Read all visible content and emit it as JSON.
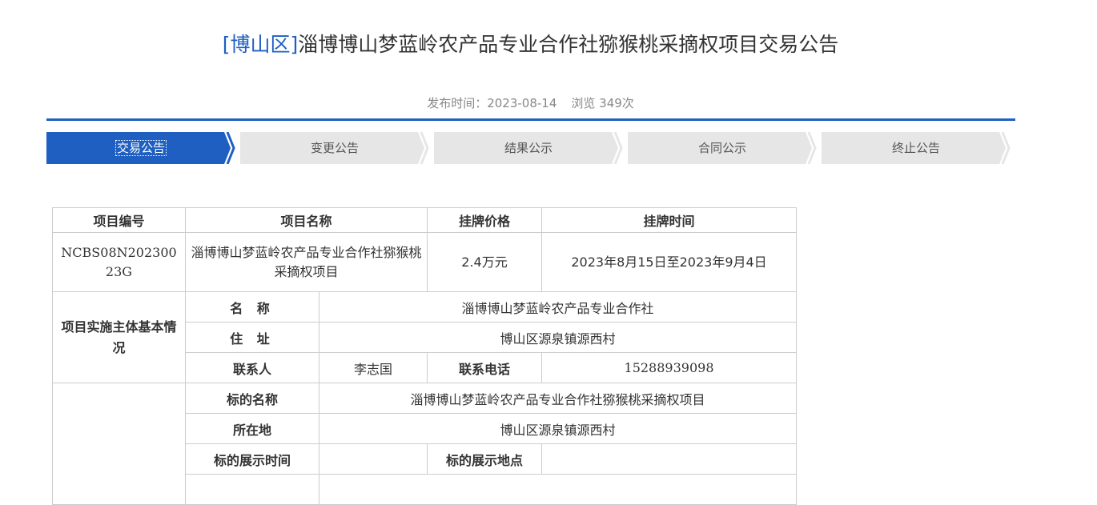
{
  "header": {
    "district": "[博山区]",
    "title": "淄博博山梦蓝岭农产品专业合作社猕猴桃采摘权项目交易公告",
    "publish_time": "发布时间：2023-08-14",
    "views": "浏览 349次"
  },
  "steps": [
    "交易公告",
    "变更公告",
    "结果公示",
    "合同公示",
    "终止公告"
  ],
  "accent_color": "#1e5fc1",
  "table": {
    "headers": {
      "project_no": "项目编号",
      "project_name": "项目名称",
      "list_price": "挂牌价格",
      "list_time": "挂牌时间"
    },
    "project": {
      "no": "NCBS08N20230023G",
      "name": "淄博博山梦蓝岭农产品专业合作社猕猴桃采摘权项目",
      "price": "2.4万元",
      "time": "2023年8月15日至2023年9月4日"
    },
    "entity_section": "项目实施主体基本情况",
    "entity": {
      "name_label": "名 称",
      "name": "淄博博山梦蓝岭农产品专业合作社",
      "address_label": "住 址",
      "address": "博山区源泉镇源西村",
      "contact_label": "联系人",
      "contact": "李志国",
      "phone_label": "联系电话",
      "phone": "15288939098"
    },
    "target": {
      "name_label": "标的名称",
      "name": "淄博博山梦蓝岭农产品专业合作社猕猴桃采摘权项目",
      "location_label": "所在地",
      "location": "博山区源泉镇源西村",
      "show_time_label": "标的展示时间",
      "show_time": "",
      "show_place_label": "标的展示地点",
      "show_place": ""
    }
  }
}
